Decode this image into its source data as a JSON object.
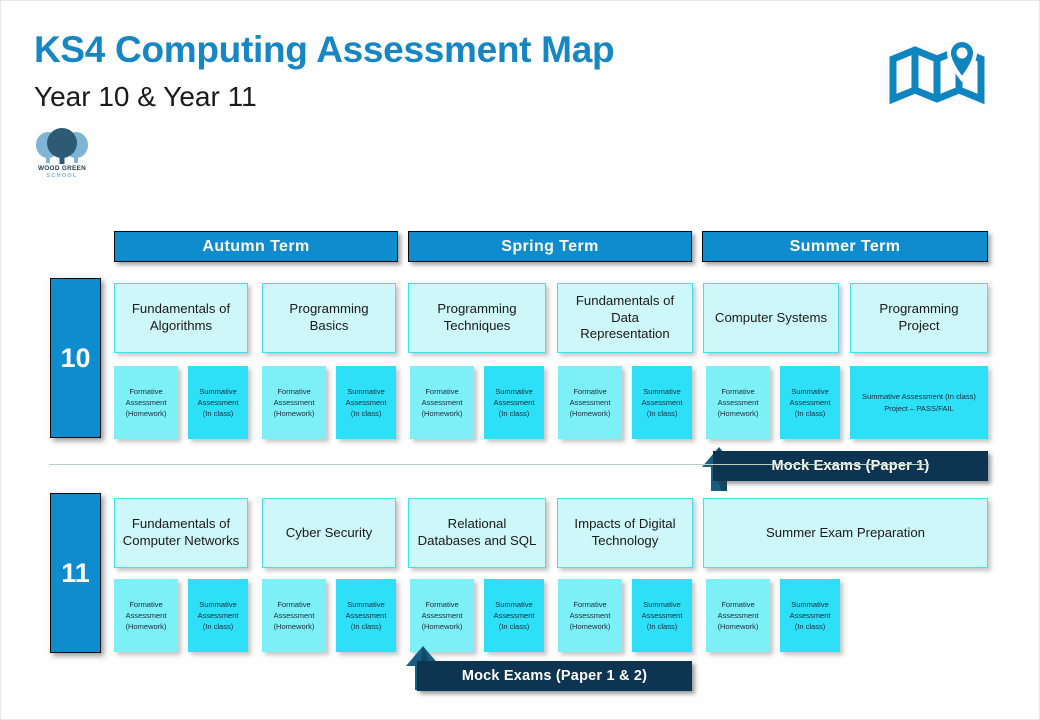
{
  "header": {
    "title": "KS4 Computing Assessment Map",
    "subtitle": "Year 10 & Year 11",
    "title_color": "#1686c4",
    "map_icon": "map-location-icon"
  },
  "school_logo": {
    "name": "WOOD GREEN",
    "sub": "SCHOOL",
    "icon": "tree-icon"
  },
  "terms": [
    {
      "label": "Autumn Term"
    },
    {
      "label": "Spring Term"
    },
    {
      "label": "Summer Term"
    }
  ],
  "colors": {
    "term_bar": "#0f8cce",
    "topic_fill": "#cdf7f8",
    "topic_border": "#3fe0ef",
    "formative_fill": "#7df0f7",
    "summative_fill": "#2ee0f7",
    "mock_banner": "#0d3450",
    "divider": "#b9cfc0"
  },
  "years": [
    {
      "label": "10",
      "topics": [
        {
          "label": "Fundamentals of Algorithms"
        },
        {
          "label": "Programming Basics"
        },
        {
          "label": "Programming Techniques"
        },
        {
          "label": "Fundamentals of Data Representation"
        },
        {
          "label": "Computer Systems"
        },
        {
          "label": "Programming Project"
        }
      ],
      "assessments": [
        {
          "type": "formative",
          "line1": "Formative",
          "line2": "Assessment",
          "line3": "(Homework)"
        },
        {
          "type": "summative",
          "line1": "Summative",
          "line2": "Assessment",
          "line3": "(In class)"
        },
        {
          "type": "formative",
          "line1": "Formative",
          "line2": "Assessment",
          "line3": "(Homework)"
        },
        {
          "type": "summative",
          "line1": "Summative",
          "line2": "Assessment",
          "line3": "(In class)"
        },
        {
          "type": "formative",
          "line1": "Formative",
          "line2": "Assessment",
          "line3": "(Homework)"
        },
        {
          "type": "summative",
          "line1": "Summative",
          "line2": "Assessment",
          "line3": "(In class)"
        },
        {
          "type": "formative",
          "line1": "Formative",
          "line2": "Assessment",
          "line3": "(Homework)"
        },
        {
          "type": "summative",
          "line1": "Summative",
          "line2": "Assessment",
          "line3": "(In class)"
        },
        {
          "type": "formative",
          "line1": "Formative",
          "line2": "Assessment",
          "line3": "(Homework)"
        },
        {
          "type": "summative",
          "line1": "Summative",
          "line2": "Assessment",
          "line3": "(In class)"
        },
        {
          "type": "summative",
          "wide": true,
          "line1": "Summative Assessment (In class)",
          "line2": "Project – PASS/FAIL",
          "line3": ""
        }
      ],
      "mock": {
        "label": "Mock Exams (Paper 1)"
      }
    },
    {
      "label": "11",
      "topics": [
        {
          "label": "Fundamentals of Computer Networks"
        },
        {
          "label": "Cyber Security"
        },
        {
          "label": "Relational Databases and SQL"
        },
        {
          "label": "Impacts of Digital Technology"
        },
        {
          "label": "Summer Exam Preparation"
        }
      ],
      "assessments": [
        {
          "type": "formative",
          "line1": "Formative",
          "line2": "Assessment",
          "line3": "(Homework)"
        },
        {
          "type": "summative",
          "line1": "Summative",
          "line2": "Assessment",
          "line3": "(In class)"
        },
        {
          "type": "formative",
          "line1": "Formative",
          "line2": "Assessment",
          "line3": "(Homework)"
        },
        {
          "type": "summative",
          "line1": "Summative",
          "line2": "Assessment",
          "line3": "(In class)"
        },
        {
          "type": "formative",
          "line1": "Formative",
          "line2": "Assessment",
          "line3": "(Homework)"
        },
        {
          "type": "summative",
          "line1": "Summative",
          "line2": "Assessment",
          "line3": "(In class)"
        },
        {
          "type": "formative",
          "line1": "Formative",
          "line2": "Assessment",
          "line3": "(Homework)"
        },
        {
          "type": "summative",
          "line1": "Summative",
          "line2": "Assessment",
          "line3": "(In class)"
        },
        {
          "type": "formative",
          "line1": "Formative",
          "line2": "Assessment",
          "line3": "(Homework)"
        },
        {
          "type": "summative",
          "line1": "Summative",
          "line2": "Assessment",
          "line3": "(In class)"
        }
      ],
      "mock": {
        "label": "Mock Exams (Paper 1 & 2)"
      }
    }
  ]
}
